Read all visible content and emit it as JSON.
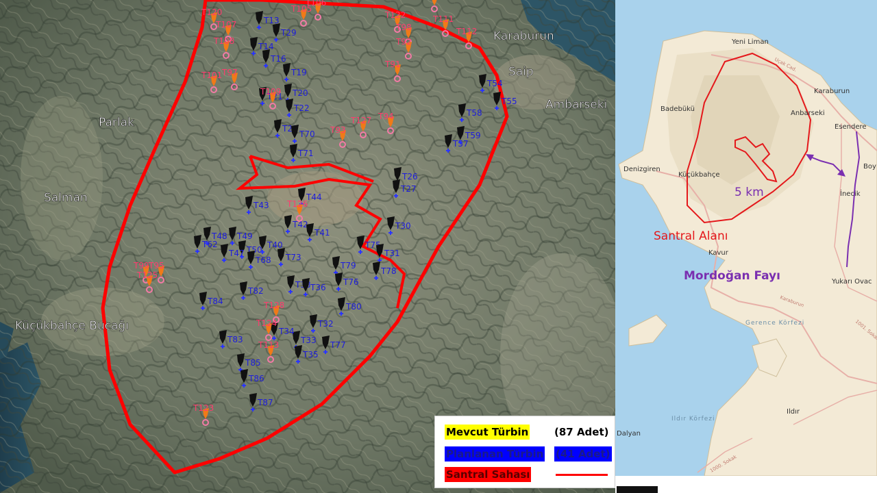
{
  "satellite": {
    "place_labels": {
      "karaburun": "Karaburun",
      "saip": "Saip",
      "ambarseki": "Ambarseki",
      "parlak": "Parlak",
      "salman": "Salman",
      "kucukbahce_bucagi": "Küçükbahçe Bucağı"
    },
    "existing_turbines_black": [
      {
        "label": "T13"
      },
      {
        "label": "T29"
      },
      {
        "label": "T14"
      },
      {
        "label": "T16"
      },
      {
        "label": "T19"
      },
      {
        "label": "T20"
      },
      {
        "label": "T22"
      },
      {
        "label": "T21"
      },
      {
        "label": "T23"
      },
      {
        "label": "T70"
      },
      {
        "label": "T71"
      },
      {
        "label": "T54"
      },
      {
        "label": "T55"
      },
      {
        "label": "T58"
      },
      {
        "label": "T57"
      },
      {
        "label": "T59"
      },
      {
        "label": "T26"
      },
      {
        "label": "T27"
      },
      {
        "label": "T44"
      },
      {
        "label": "T43"
      },
      {
        "label": "T42"
      },
      {
        "label": "T41"
      },
      {
        "label": "T30"
      },
      {
        "label": "T48"
      },
      {
        "label": "T49"
      },
      {
        "label": "T50"
      },
      {
        "label": "T47"
      },
      {
        "label": "T40"
      },
      {
        "label": "T62"
      },
      {
        "label": "T68"
      },
      {
        "label": "T73"
      },
      {
        "label": "T75"
      },
      {
        "label": "T79"
      },
      {
        "label": "T31"
      },
      {
        "label": "T76"
      },
      {
        "label": "T78"
      },
      {
        "label": "T38"
      },
      {
        "label": "T36"
      },
      {
        "label": "T82"
      },
      {
        "label": "T84"
      },
      {
        "label": "T80"
      },
      {
        "label": "T32"
      },
      {
        "label": "T77"
      },
      {
        "label": "T33"
      },
      {
        "label": "T35"
      },
      {
        "label": "T83"
      },
      {
        "label": "T85"
      },
      {
        "label": "T86"
      },
      {
        "label": "T87"
      },
      {
        "label": "T34"
      }
    ],
    "planned_turbines_orange": [
      {
        "label": "T120"
      },
      {
        "label": "T105"
      },
      {
        "label": "T106"
      },
      {
        "label": "T107"
      },
      {
        "label": "T103"
      },
      {
        "label": "T122"
      },
      {
        "label": "T111"
      },
      {
        "label": "T98"
      },
      {
        "label": "T112"
      },
      {
        "label": "T92"
      },
      {
        "label": "T91"
      },
      {
        "label": "T108"
      },
      {
        "label": "T101"
      },
      {
        "label": "T97"
      },
      {
        "label": "T109"
      },
      {
        "label": "T127"
      },
      {
        "label": "T94"
      },
      {
        "label": "T93"
      },
      {
        "label": "T99"
      },
      {
        "label": "T95"
      },
      {
        "label": "T125"
      },
      {
        "label": "T126"
      },
      {
        "label": "T128"
      },
      {
        "label": "T124"
      },
      {
        "label": "T113"
      },
      {
        "label": "T123"
      }
    ]
  },
  "topo": {
    "labels": {
      "yeni_liman": "Yeni Liman",
      "karaburun": "Karaburun",
      "badebuku": "Badebükü",
      "anbarseki": "Anbarseki",
      "esendere": "Esendere",
      "denizgiren": "Denizgiren",
      "kucukbahce": "Küçükbahçe",
      "boy": "Boy",
      "inecik": "İnecik",
      "kavur": "Kavur",
      "yukari_ovac": "Yukarı Ovac",
      "gerence_korfezi": "Gerence Körfezi",
      "ildir_korfezi": "Ildır Körfezi",
      "ildir": "Ildır",
      "dalyan": "Dalyan",
      "road_karaburun": "Karaburun",
      "road_ucak": "Uçak Cad.",
      "road_sokak": "1001. Sokak",
      "road_sokak2": "1000. Sokak"
    },
    "scale_text": "5 km",
    "santral_alani": "Santral Alanı",
    "mordogan_fayi": "Mordoğan Fayı",
    "colors": {
      "boundary": "#e4181b",
      "fault": "#7a2fb0"
    }
  },
  "legend": {
    "existing": {
      "name": "Mevcut Türbin",
      "count": "(87 Adet)",
      "color": "#ffff00"
    },
    "planned": {
      "name": "Planlanan Türbin",
      "count": "(41 Adet)",
      "color": "#0000ff"
    },
    "site": {
      "name": "Santral Sahası",
      "color": "#ff0000"
    }
  }
}
